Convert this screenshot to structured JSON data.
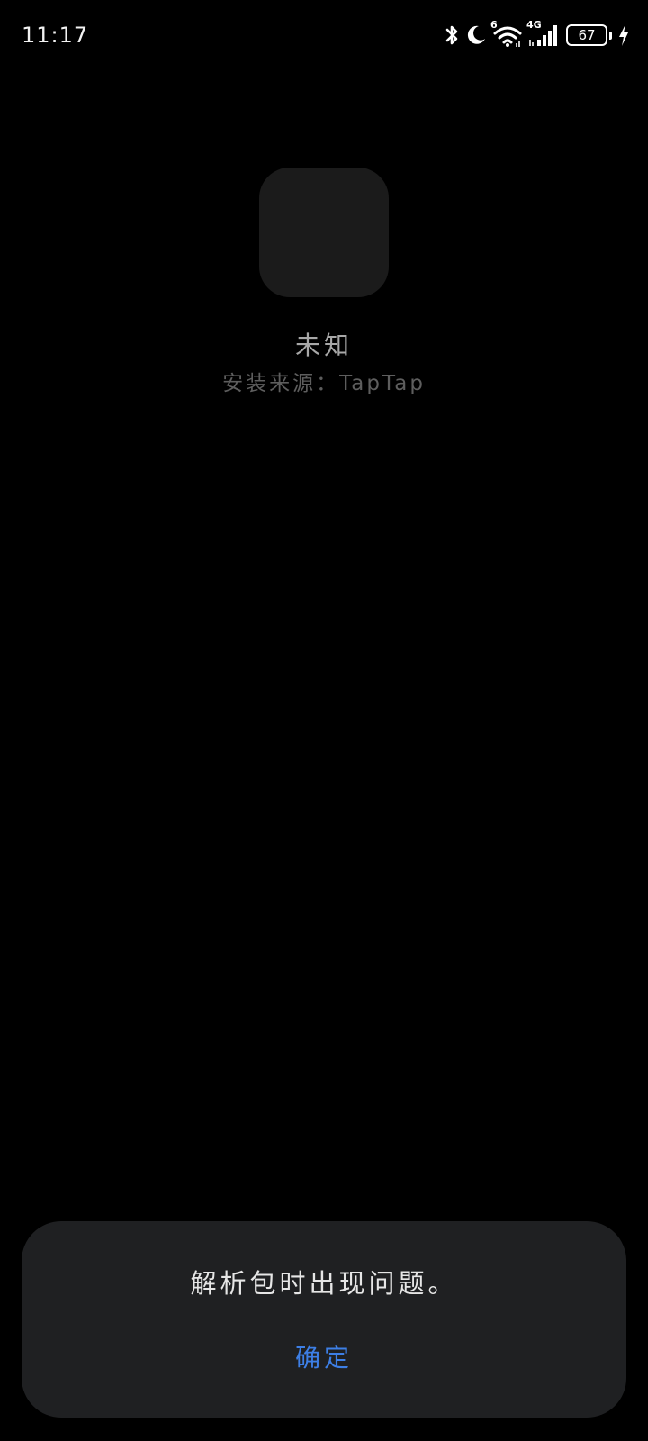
{
  "status_bar": {
    "time": "11:17",
    "battery_level": "67",
    "icons": [
      "bluetooth-icon",
      "moon-icon",
      "wifi-icon",
      "signal-icon",
      "battery-icon",
      "charging-icon"
    ],
    "wifi_badge": "6",
    "network_type": "4G"
  },
  "app": {
    "name": "未知",
    "source": "安装来源：TapTap"
  },
  "dialog": {
    "message": "解析包时出现问题。",
    "confirm_label": "确定"
  },
  "colors": {
    "background": "#000000",
    "dialog_background": "#1f2022",
    "accent": "#3d7fe6",
    "icon_placeholder": "#1b1b1b"
  }
}
